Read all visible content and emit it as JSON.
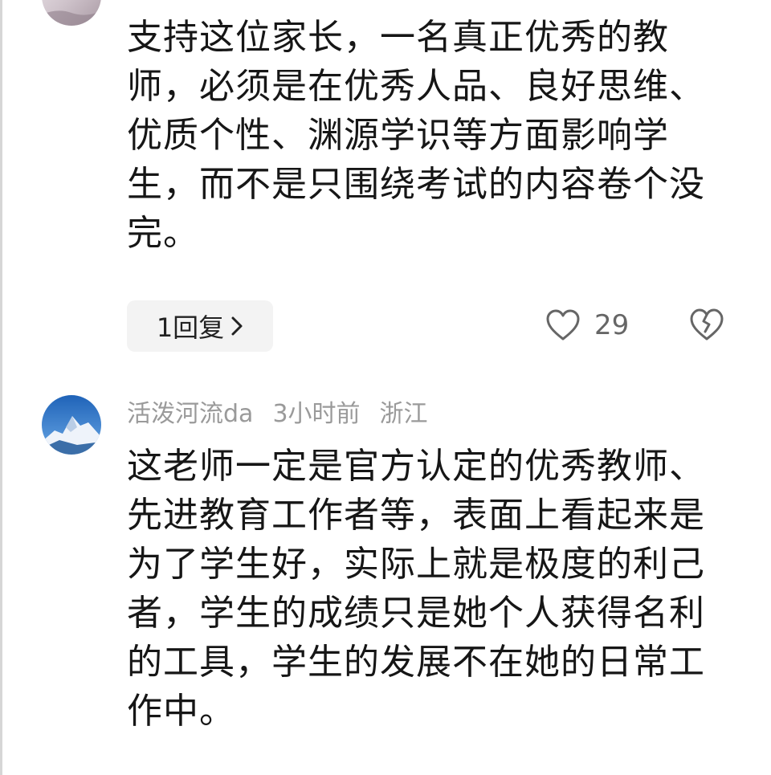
{
  "comments": [
    {
      "body": "支持这位家长，一名真正优秀的教师，必须是在优秀人品、良好思维、优质个性、渊源学识等方面影响学生，而不是只围绕考试的内容卷个没完。",
      "reply_label": "1回复",
      "likes": "29"
    },
    {
      "username": "活泼河流da",
      "time": "3小时前",
      "location": "浙江",
      "body": "这老师一定是官方认定的优秀教师、先进教育工作者等，表面上看起来是为了学生好，实际上就是极度的利己者，学生的成绩只是她个人获得名利的工具，学生的发展不在她的日常工作中。"
    }
  ],
  "icons": {
    "like": "heart-outline-icon",
    "dislike": "broken-heart-icon",
    "reply_chevron": "chevron-right-icon"
  },
  "colors": {
    "text": "#161616",
    "meta": "#9a9a9a",
    "pill_bg": "#f3f3f3",
    "icon": "#666666"
  }
}
